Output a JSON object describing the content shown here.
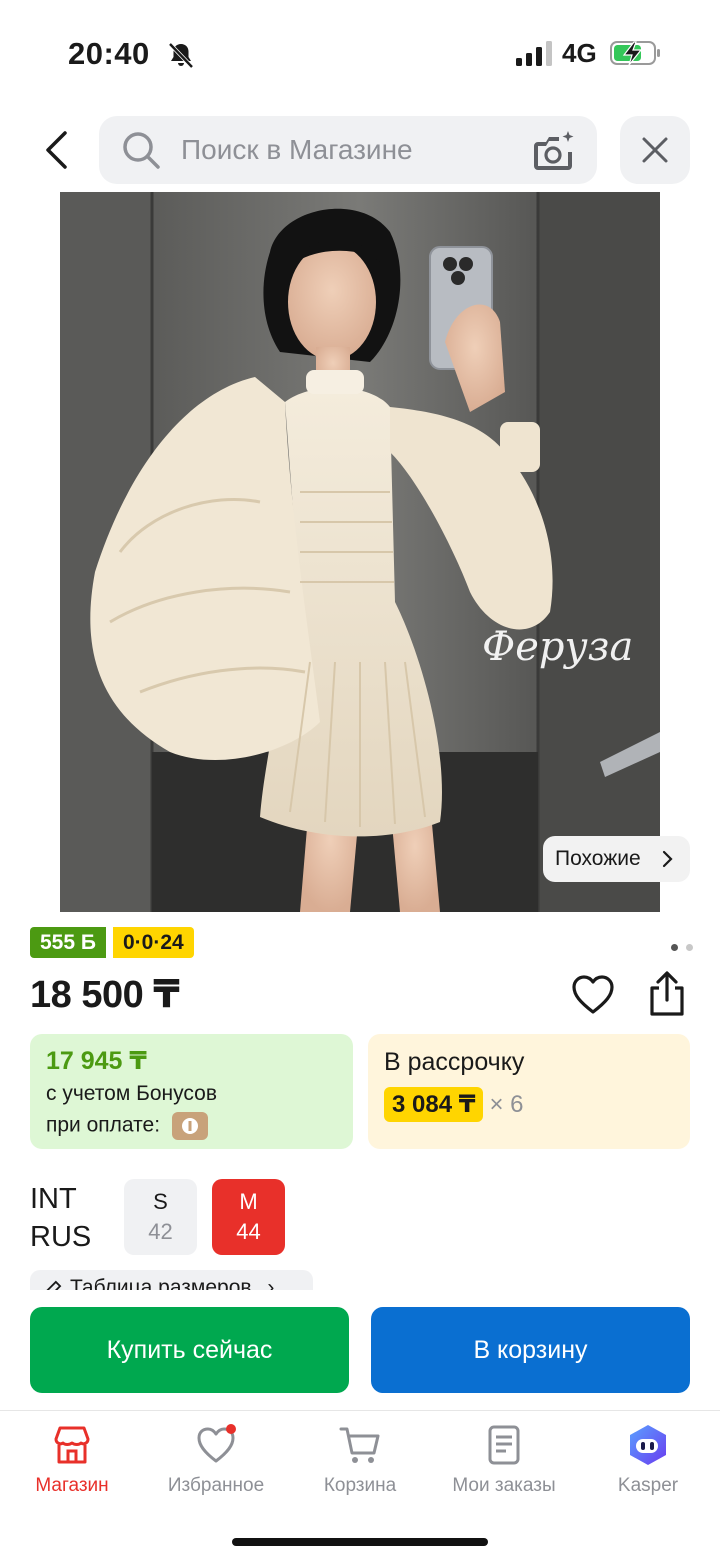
{
  "status_bar": {
    "time": "20:40",
    "network": "4G"
  },
  "search": {
    "placeholder": "Поиск в Магазине"
  },
  "product": {
    "watermark": "Феруза",
    "similar_label": "Похожие",
    "bonus_badge": "555 Б",
    "installment_badge": "0·0·24",
    "price": "18 500 ₸",
    "gallery_dots": {
      "total": 2,
      "active": 1
    }
  },
  "bonus_card": {
    "price": "17 945 ₸",
    "line1": "с учетом Бонусов",
    "line2": "при оплате:"
  },
  "installment_card": {
    "title": "В рассрочку",
    "amount": "3 084 ₸",
    "multiplier": "× 6"
  },
  "sizes": {
    "systems": [
      "INT",
      "RUS"
    ],
    "options": [
      {
        "int": "S",
        "rus": "42",
        "selected": false
      },
      {
        "int": "M",
        "rus": "44",
        "selected": true
      }
    ],
    "table_label": "Таблица размеров"
  },
  "actions": {
    "buy_now": "Купить сейчас",
    "add_to_cart": "В корзину"
  },
  "tabs": [
    {
      "label": "Магазин",
      "icon": "store-icon",
      "active": true
    },
    {
      "label": "Избранное",
      "icon": "heart-icon",
      "active": false,
      "notification": true
    },
    {
      "label": "Корзина",
      "icon": "cart-icon",
      "active": false
    },
    {
      "label": "Мои заказы",
      "icon": "orders-icon",
      "active": false
    },
    {
      "label": "Kasper",
      "icon": "kasper-assistant-icon",
      "active": false
    }
  ],
  "colors": {
    "brand_red": "#e8302a",
    "buy_green": "#00a84f",
    "cart_blue": "#0a6fd1",
    "bonus_green": "#4c9a12",
    "installment_yellow": "#ffd500"
  }
}
